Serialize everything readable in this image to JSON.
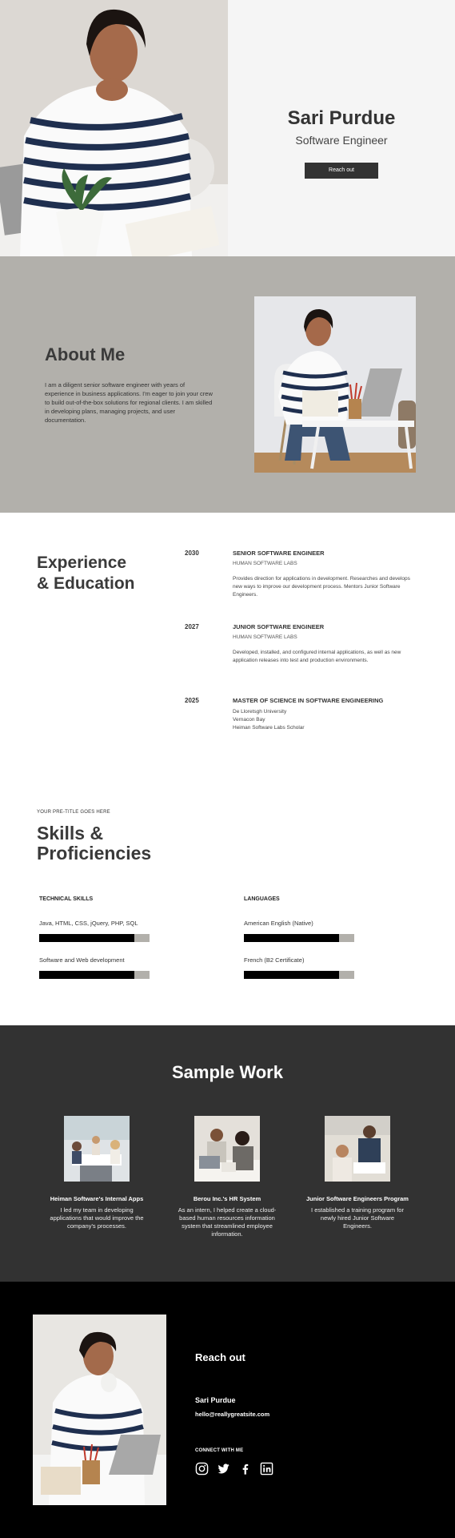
{
  "hero": {
    "name": "Sari Purdue",
    "role": "Software Engineer",
    "button_label": "Reach out"
  },
  "about": {
    "title": "About Me",
    "body": "I am a diligent senior software engineer with years of experience in business applications. I'm eager to join your crew to build out-of-the-box solutions for regional clients. I am skilled in developing plans, managing projects, and user documentation."
  },
  "experience": {
    "title_line1": "Experience",
    "title_line2": "& Education",
    "items": [
      {
        "year": "2030",
        "role": "SENIOR SOFTWARE ENGINEER",
        "company": "HUMAN SOFTWARE LABS",
        "desc": "Provides direction for applications in development. Researches and develops new ways to improve our development process. Mentors Junior Software Engineers."
      },
      {
        "year": "2027",
        "role": "JUNIOR SOFTWARE ENGINEER",
        "company": "HUMAN SOFTWARE LABS",
        "desc": "Developed, installed, and configured internal applications, as well as new application releases into test and production environments."
      },
      {
        "year": "2025",
        "role": "MASTER OF SCIENCE IN SOFTWARE ENGINEERING",
        "lines": [
          "De Lloretsgh University",
          "Vernacon Bay",
          "Heiman Software Labs Scholar"
        ]
      }
    ]
  },
  "skills": {
    "pretitle": "YOUR PRE-TITLE GOES HERE",
    "title_line1": "Skills &",
    "title_line2": "Proficiencies",
    "technical": {
      "heading": "TECHNICAL SKILLS",
      "items": [
        {
          "label": "Java, HTML, CSS, jQuery, PHP, SQL",
          "level": 0.86
        },
        {
          "label": "Software and Web development",
          "level": 0.86
        }
      ]
    },
    "languages": {
      "heading": "LANGUAGES",
      "items": [
        {
          "label": "American English (Native)",
          "level": 0.86
        },
        {
          "label": "French (B2 Certificate)",
          "level": 0.86
        }
      ]
    }
  },
  "work": {
    "title": "Sample Work",
    "items": [
      {
        "name": "Heiman Software's Internal Apps",
        "desc": "I led my team in developing applications that would improve the company's processes."
      },
      {
        "name": "Berou Inc.'s HR System",
        "desc": "As an intern, I helped create a cloud-based human resources information system that streamlined employee information."
      },
      {
        "name": "Junior Software Engineers Program",
        "desc": "I established a training program for newly hired Junior Software Engineers."
      }
    ]
  },
  "contact": {
    "title": "Reach out",
    "name": "Sari Purdue",
    "email": "hello@reallygreatsite.com",
    "connect_label": "CONNECT WITH ME",
    "socials": [
      "instagram-icon",
      "twitter-icon",
      "facebook-icon",
      "linkedin-icon"
    ]
  },
  "colors": {
    "hero_bg": "#f5f5f5",
    "about_bg": "#b2b0ab",
    "work_bg": "#323232",
    "contact_bg": "#000000",
    "button": "#333333"
  }
}
